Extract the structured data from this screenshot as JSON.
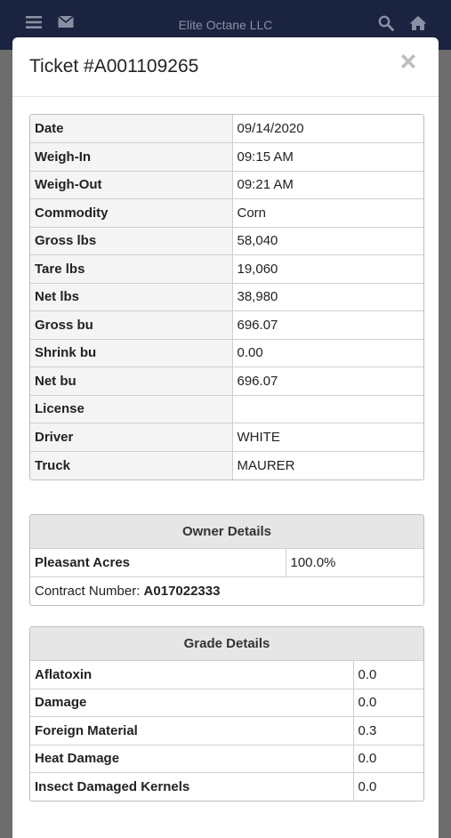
{
  "app": {
    "company": "Elite Octane LLC"
  },
  "modal": {
    "title": "Ticket #A001109265"
  },
  "ticket_rows": [
    {
      "label": "Date",
      "value": "09/14/2020"
    },
    {
      "label": "Weigh-In",
      "value": "09:15 AM"
    },
    {
      "label": "Weigh-Out",
      "value": "09:21 AM"
    },
    {
      "label": "Commodity",
      "value": "Corn"
    },
    {
      "label": "Gross lbs",
      "value": "58,040"
    },
    {
      "label": "Tare lbs",
      "value": "19,060"
    },
    {
      "label": "Net lbs",
      "value": "38,980"
    },
    {
      "label": "Gross bu",
      "value": "696.07"
    },
    {
      "label": "Shrink bu",
      "value": "0.00"
    },
    {
      "label": "Net bu",
      "value": "696.07"
    },
    {
      "label": "License",
      "value": ""
    },
    {
      "label": "Driver",
      "value": "WHITE"
    },
    {
      "label": "Truck",
      "value": "MAURER"
    }
  ],
  "owner": {
    "heading": "Owner Details",
    "name": "Pleasant Acres",
    "percent": "100.0%",
    "contract_label": "Contract Number: ",
    "contract_number": "A017022333"
  },
  "grade": {
    "heading": "Grade Details",
    "rows": [
      {
        "label": "Aflatoxin",
        "value": "0.0"
      },
      {
        "label": "Damage",
        "value": "0.0"
      },
      {
        "label": "Foreign Material",
        "value": "0.3"
      },
      {
        "label": "Heat Damage",
        "value": "0.0"
      },
      {
        "label": "Insect Damaged Kernels",
        "value": "0.0"
      }
    ]
  },
  "icons": {
    "menu": "menu-icon",
    "mail": "mail-icon",
    "search": "search-icon",
    "home": "home-icon",
    "close": "close-icon"
  },
  "colors": {
    "navbar": "#1a2340",
    "backdrop": "#6d6d6d",
    "header_bg": "#e6e6e6"
  }
}
